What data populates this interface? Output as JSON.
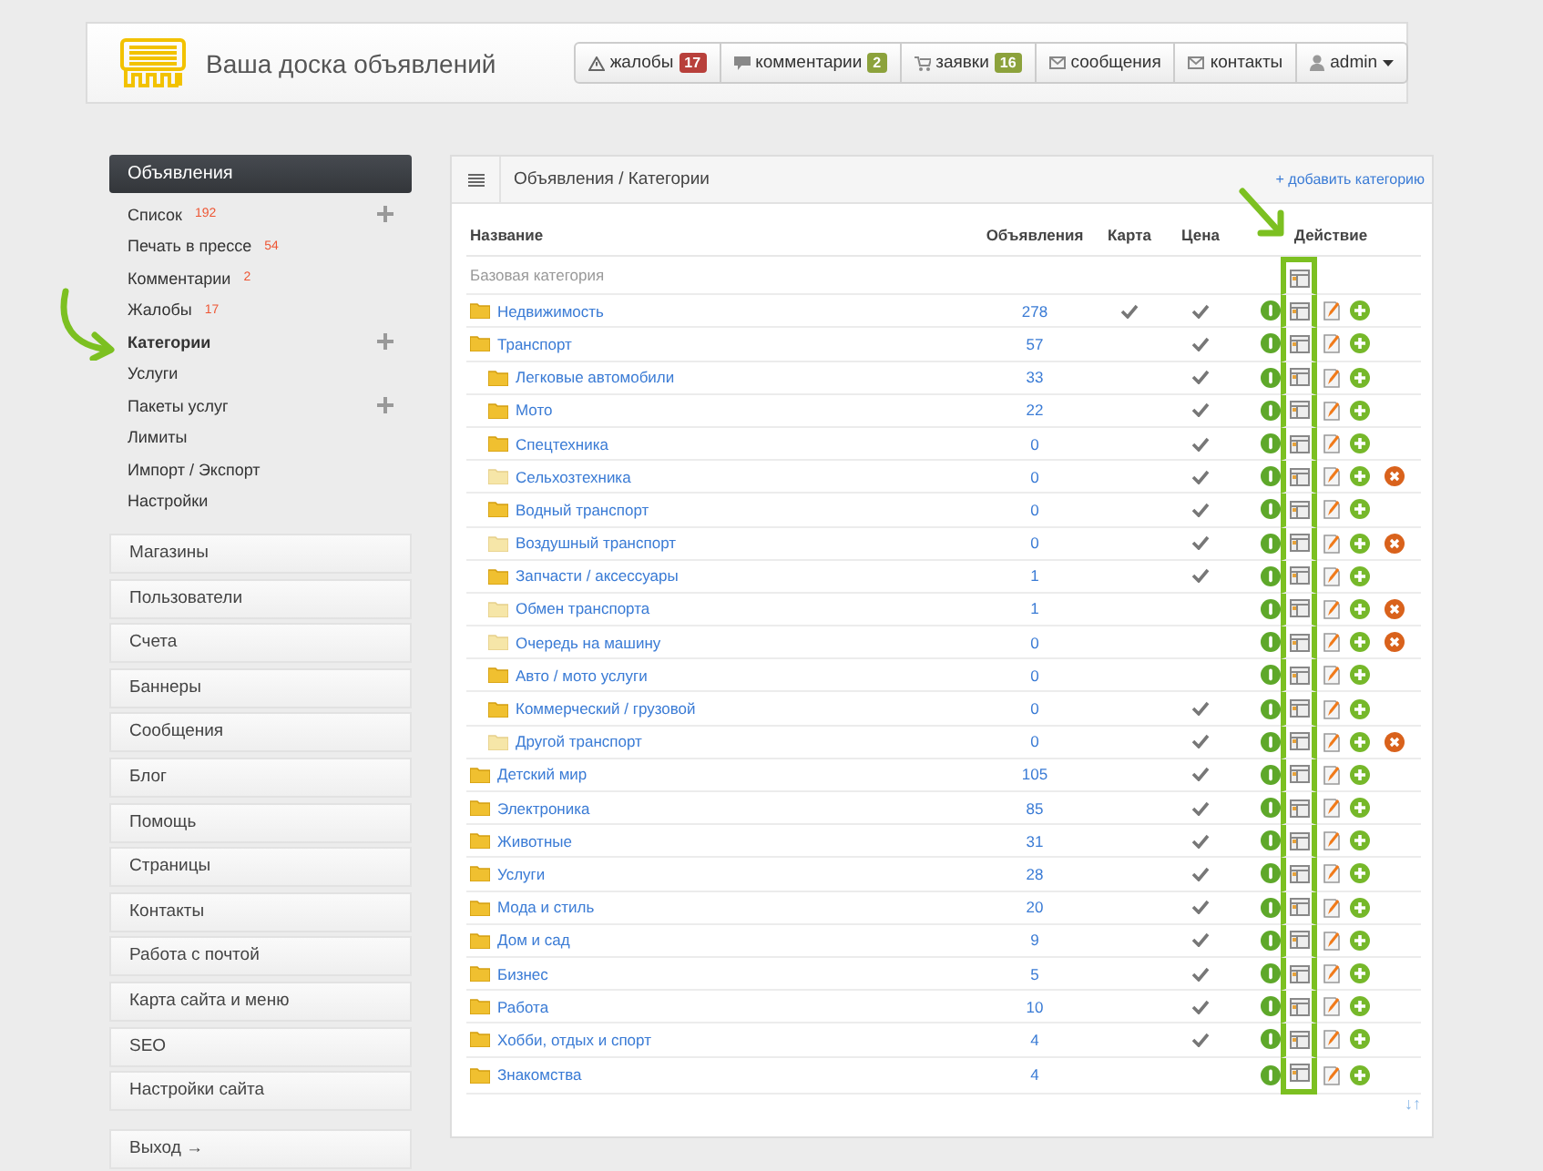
{
  "header": {
    "title": "Ваша доска объявлений",
    "nav": [
      {
        "label": "жалобы",
        "badge": "17",
        "color": "#b8403b"
      },
      {
        "label": "комментарии",
        "badge": "2",
        "color": "#8ca23c"
      },
      {
        "label": "заявки",
        "badge": "16",
        "color": "#8ca23c"
      },
      {
        "label": "сообщения"
      },
      {
        "label": "контакты"
      },
      {
        "label": "admin",
        "dropdown": true
      }
    ]
  },
  "sidebar": {
    "section": {
      "title": "Объявления",
      "items": [
        {
          "label": "Список",
          "count": "192",
          "expandable": true,
          "selected": false
        },
        {
          "label": "Печать в прессе",
          "count": "54",
          "expandable": false,
          "selected": false
        },
        {
          "label": "Комментарии",
          "count": "2",
          "expandable": false,
          "selected": false
        },
        {
          "label": "Жалобы",
          "count": "17",
          "expandable": false,
          "selected": false
        },
        {
          "label": "Категории",
          "expandable": true,
          "selected": true
        },
        {
          "label": "Услуги",
          "expandable": false,
          "selected": false
        },
        {
          "label": "Пакеты услуг",
          "expandable": true,
          "selected": false
        },
        {
          "label": "Лимиты",
          "expandable": false,
          "selected": false
        },
        {
          "label": "Импорт / Экспорт",
          "expandable": false,
          "selected": false
        },
        {
          "label": "Настройки",
          "expandable": false,
          "selected": false
        }
      ]
    },
    "menu": [
      "Магазины",
      "Пользователи",
      "Счета",
      "Баннеры",
      "Сообщения",
      "Блог",
      "Помощь",
      "Страницы",
      "Контакты",
      "Работа с почтой",
      "Карта сайта и меню",
      "SEO",
      "Настройки сайта"
    ],
    "exit": "Выход →"
  },
  "panel": {
    "breadcrumb": "Объявления / Категории",
    "add_link": "+ добавить категорию",
    "columns": [
      "Название",
      "Объявления",
      "Карта",
      "Цена",
      "Действие"
    ],
    "rows": [
      {
        "kind": "base",
        "name": "Базовая категория"
      },
      {
        "kind": "category",
        "name": "Недвижимость",
        "count": "278",
        "map": true,
        "price": true,
        "disabled": false,
        "deletable": false
      },
      {
        "kind": "category",
        "name": "Транспорт",
        "count": "57",
        "map": false,
        "price": true,
        "disabled": false,
        "deletable": false,
        "children": [
          {
            "kind": "category",
            "name": "Легковые автомобили",
            "count": "33",
            "map": false,
            "price": true,
            "disabled": false,
            "deletable": false
          },
          {
            "kind": "category",
            "name": "Мото",
            "count": "22",
            "map": false,
            "price": true,
            "disabled": false,
            "deletable": false
          },
          {
            "kind": "category",
            "name": "Спецтехника",
            "count": "0",
            "map": false,
            "price": true,
            "disabled": false,
            "deletable": false
          },
          {
            "kind": "category",
            "name": "Сельхозтехника",
            "count": "0",
            "map": false,
            "price": true,
            "disabled": true,
            "deletable": true
          },
          {
            "kind": "category",
            "name": "Водный транспорт",
            "count": "0",
            "map": false,
            "price": true,
            "disabled": false,
            "deletable": false
          },
          {
            "kind": "category",
            "name": "Воздушный транспорт",
            "count": "0",
            "map": false,
            "price": true,
            "disabled": true,
            "deletable": true
          },
          {
            "kind": "category",
            "name": "Запчасти / аксессуары",
            "count": "1",
            "map": false,
            "price": true,
            "disabled": false,
            "deletable": false
          },
          {
            "kind": "category",
            "name": "Обмен транспорта",
            "count": "1",
            "map": false,
            "price": false,
            "disabled": true,
            "deletable": true
          },
          {
            "kind": "category",
            "name": "Очередь на машину",
            "count": "0",
            "map": false,
            "price": false,
            "disabled": true,
            "deletable": true
          },
          {
            "kind": "category",
            "name": "Авто / мото услуги",
            "count": "0",
            "map": false,
            "price": false,
            "disabled": false,
            "deletable": false
          },
          {
            "kind": "category",
            "name": "Коммерческий / грузовой",
            "count": "0",
            "map": false,
            "price": true,
            "disabled": false,
            "deletable": false
          },
          {
            "kind": "category",
            "name": "Другой транспорт",
            "count": "0",
            "map": false,
            "price": true,
            "disabled": true,
            "deletable": true
          }
        ]
      },
      {
        "kind": "category",
        "name": "Детский мир",
        "count": "105",
        "map": false,
        "price": true,
        "disabled": false,
        "deletable": false
      },
      {
        "kind": "category",
        "name": "Электроника",
        "count": "85",
        "map": false,
        "price": true,
        "disabled": false,
        "deletable": false
      },
      {
        "kind": "category",
        "name": "Животные",
        "count": "31",
        "map": false,
        "price": true,
        "disabled": false,
        "deletable": false
      },
      {
        "kind": "category",
        "name": "Услуги",
        "count": "28",
        "map": false,
        "price": true,
        "disabled": false,
        "deletable": false
      },
      {
        "kind": "category",
        "name": "Мода и стиль",
        "count": "20",
        "map": false,
        "price": true,
        "disabled": false,
        "deletable": false
      },
      {
        "kind": "category",
        "name": "Дом и сад",
        "count": "9",
        "map": false,
        "price": true,
        "disabled": false,
        "deletable": false
      },
      {
        "kind": "category",
        "name": "Бизнес",
        "count": "5",
        "map": false,
        "price": true,
        "disabled": false,
        "deletable": false
      },
      {
        "kind": "category",
        "name": "Работа",
        "count": "10",
        "map": false,
        "price": true,
        "disabled": false,
        "deletable": false
      },
      {
        "kind": "category",
        "name": "Хобби, отдых и спорт",
        "count": "4",
        "map": false,
        "price": true,
        "disabled": false,
        "deletable": false
      },
      {
        "kind": "category",
        "name": "Знакомства",
        "count": "4",
        "map": false,
        "price": false,
        "disabled": false,
        "deletable": false
      }
    ],
    "sort_toggle": "↓↑"
  }
}
